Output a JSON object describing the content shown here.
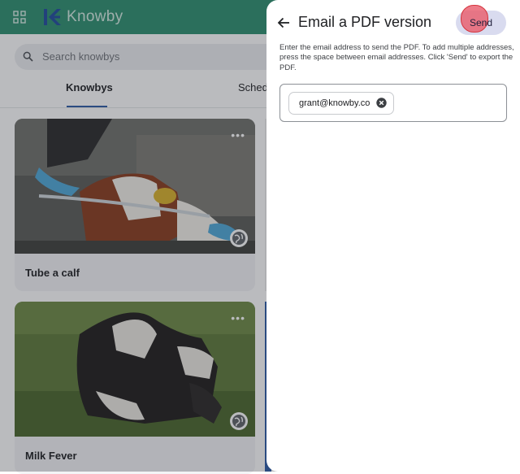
{
  "app": {
    "brand": "Knowby"
  },
  "search": {
    "placeholder": "Search knowbys"
  },
  "tabs": [
    {
      "label": "Knowbys"
    },
    {
      "label": "Sched"
    }
  ],
  "cards": [
    {
      "title": "Tube a calf"
    },
    {
      "title": "Milk Fever"
    }
  ],
  "panel": {
    "title": "Email a PDF version",
    "send_label": "Send",
    "instructions": "Enter the email address to send the PDF. To add multiple addresses, press the space between email addresses. Click 'Send' to export the PDF.",
    "emails": [
      "grant@knowby.co"
    ]
  },
  "icons": {
    "apps": "grid-icon",
    "back": "arrow-left-icon",
    "remove": "close-circle-icon",
    "search": "search-icon",
    "globe": "globe-icon",
    "more": "more-horizontal-icon"
  },
  "colors": {
    "header": "#2d8f6f",
    "tab_indicator": "#2b5aa6",
    "send_button": "#d9dbef"
  }
}
